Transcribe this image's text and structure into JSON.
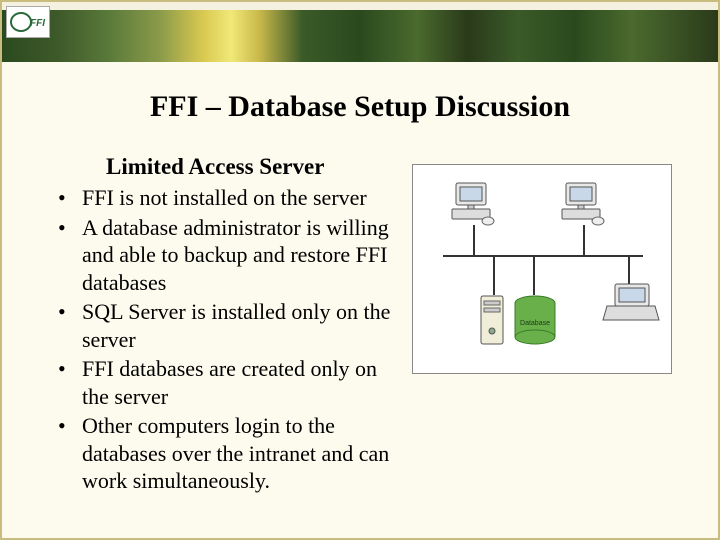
{
  "logo_text": "FFI",
  "title": "FFI – Database Setup Discussion",
  "subtitle": "Limited Access Server",
  "bullets": [
    "FFI is not installed on the server",
    "A database administrator is willing and able to backup and restore FFI databases",
    "SQL Server is installed only on the server",
    "FFI databases are created only on the server",
    "Other computers login to the databases over the intranet and can work simultaneously."
  ],
  "diagram_label": "Database"
}
